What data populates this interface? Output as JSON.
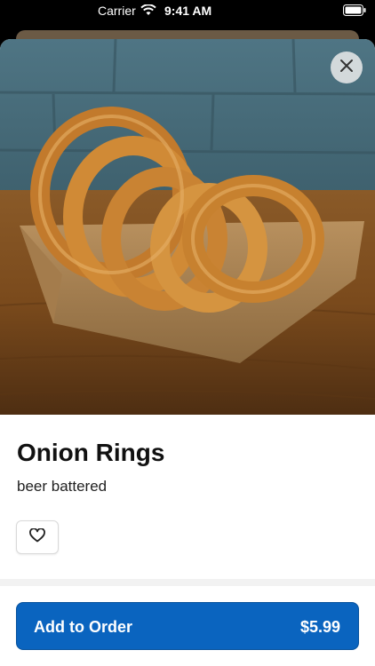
{
  "status_bar": {
    "carrier": "Carrier",
    "time": "9:41 AM",
    "wifi_icon": "wifi-icon",
    "battery_icon": "battery-icon"
  },
  "hero": {
    "image_subject": "onion-rings-in-paper-boat"
  },
  "item": {
    "title": "Onion Rings",
    "description": "beer battered",
    "price": "$5.99"
  },
  "actions": {
    "close_icon": "close-icon",
    "favorite_icon": "heart-icon",
    "add_label": "Add to Order"
  },
  "colors": {
    "primary": "#0a64bf",
    "text": "#111111"
  }
}
